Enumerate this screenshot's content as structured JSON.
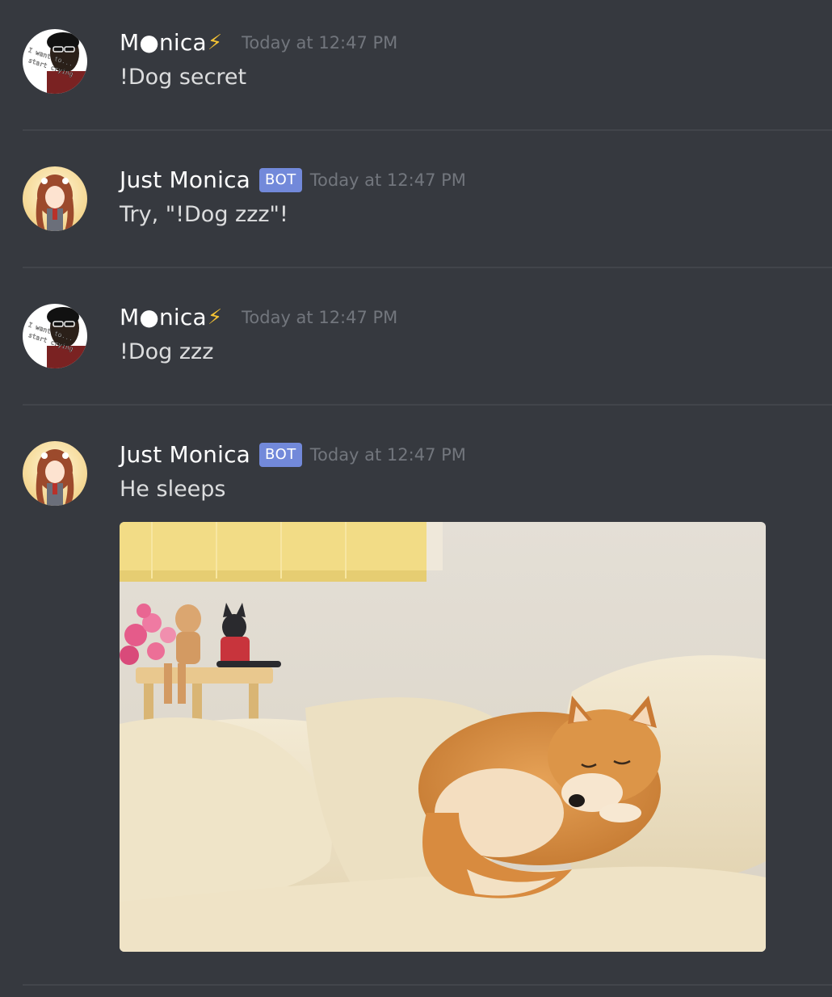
{
  "messages": [
    {
      "username": "M●nica",
      "badge_icon": "lightning-bolt-icon",
      "badge_glyph": "⚡",
      "timestamp": "Today at 12:47 PM",
      "content": "!Dog secret",
      "avatar_text": [
        "I want to...",
        "start crying"
      ]
    },
    {
      "username": "Just Monica",
      "bot_tag": "BOT",
      "timestamp": "Today at 12:47 PM",
      "content": "Try, \"!Dog zzz\"!"
    },
    {
      "username": "M●nica",
      "badge_icon": "lightning-bolt-icon",
      "badge_glyph": "⚡",
      "timestamp": "Today at 12:47 PM",
      "content": "!Dog zzz",
      "avatar_text": [
        "I want to...",
        "start crying"
      ]
    },
    {
      "username": "Just Monica",
      "bot_tag": "BOT",
      "timestamp": "Today at 12:47 PM",
      "content": "He sleeps",
      "attachment": "image of a sleeping shiba inu dog on a cushion"
    }
  ],
  "colors": {
    "background": "#36393f",
    "username": "#ffffff",
    "text": "#dcddde",
    "timestamp": "#72767d",
    "bot_tag": "#7289da",
    "divider": "#42454b",
    "bolt": "#f4c234"
  }
}
